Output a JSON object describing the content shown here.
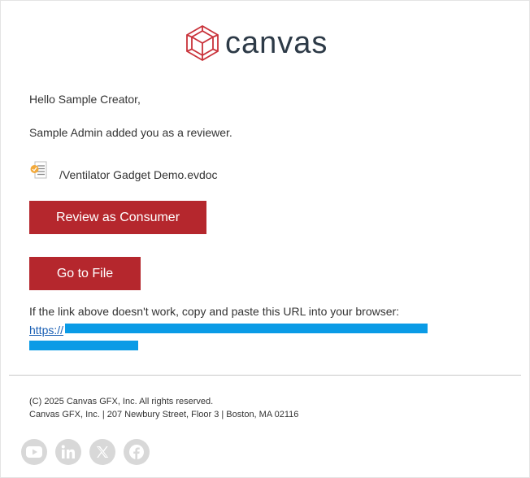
{
  "brand": {
    "name": "canvas",
    "accent_color": "#b5272d",
    "logo_icon": "canvas-cube-logo-icon"
  },
  "email": {
    "greeting": "Hello Sample Creator,",
    "message": "Sample Admin added you as a reviewer.",
    "file": {
      "icon": "document-icon",
      "path": "/Ventilator Gadget Demo.evdoc"
    },
    "buttons": {
      "review_label": "Review as Consumer",
      "goto_label": "Go to File"
    },
    "fallback_text": "If the link above doesn't work, copy and paste this URL into your browser:",
    "url_prefix": "https://"
  },
  "footer": {
    "copyright": "(C) 2025 Canvas GFX, Inc. All rights reserved.",
    "address": "Canvas GFX, Inc. | 207 Newbury Street, Floor 3 | Boston, MA 02116",
    "social": [
      {
        "name": "youtube-icon"
      },
      {
        "name": "linkedin-icon"
      },
      {
        "name": "x-icon"
      },
      {
        "name": "facebook-icon"
      }
    ]
  }
}
